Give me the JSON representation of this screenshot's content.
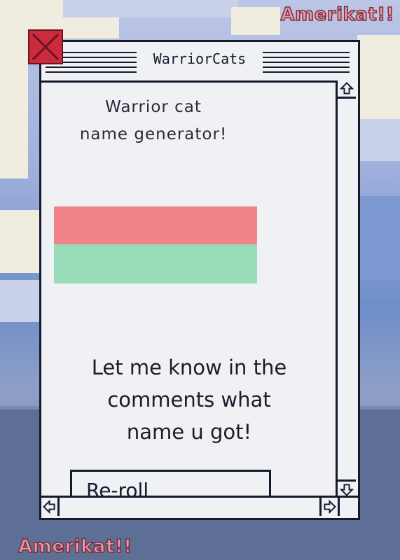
{
  "branding": {
    "top_text": "Amerikat!!",
    "bottom_text": "Amerikat!!"
  },
  "window": {
    "title": "WarriorCats",
    "close_icon": "close-x-icon",
    "heading_line1": "Warrior cat",
    "heading_line2": "name generator!",
    "result_colors": {
      "top": "#ef858b",
      "bottom": "#97dbb9"
    },
    "message_line1": "Let me know in the",
    "message_line2": "comments what",
    "message_line3": "name u got!",
    "reroll_label": "Re-roll",
    "scroll_icons": [
      "up-arrow-icon",
      "down-arrow-icon",
      "left-arrow-icon",
      "right-arrow-icon"
    ]
  }
}
